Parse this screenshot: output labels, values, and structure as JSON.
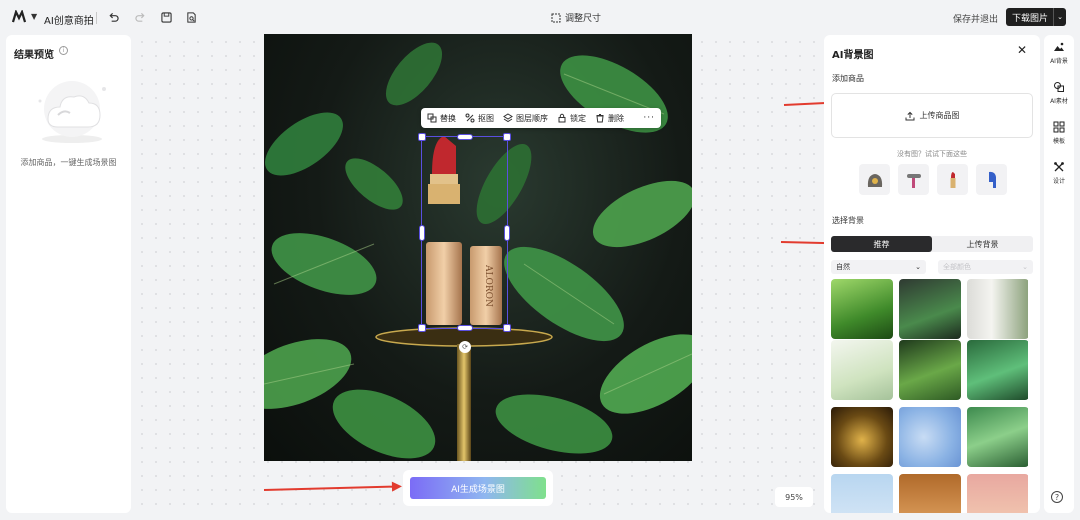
{
  "topbar": {
    "app_title": "AI创意商拍",
    "resize_label": "调整尺寸",
    "save_exit_label": "保存并退出",
    "download_label": "下载图片"
  },
  "left_panel": {
    "title": "结果预览",
    "hint": "添加商品，一键生成场景图"
  },
  "canvas": {
    "toolbar": {
      "replace": "替换",
      "cutout": "抠图",
      "layer_order": "图层顺序",
      "lock": "锁定",
      "delete": "删除",
      "more": "···"
    },
    "product_brand": "ALORON",
    "generate_label": "AI生成场景图",
    "zoom": "95%"
  },
  "right_panel": {
    "title": "AI背景图",
    "add_product_label": "添加商品",
    "upload_product_label": "上传商品图",
    "try_hint": "没有图？试试下面这些",
    "select_bg_label": "选择背景",
    "tabs": [
      "推荐",
      "上传背景"
    ],
    "filter_style": "自然",
    "filter_color": "全部颜色"
  },
  "rail": {
    "items": [
      "AI背景",
      "AI素材",
      "模板",
      "设计"
    ]
  },
  "colors": {
    "accent": "#5a4fe0",
    "arrow": "#e23b2e",
    "dark": "#1f1f1f"
  }
}
